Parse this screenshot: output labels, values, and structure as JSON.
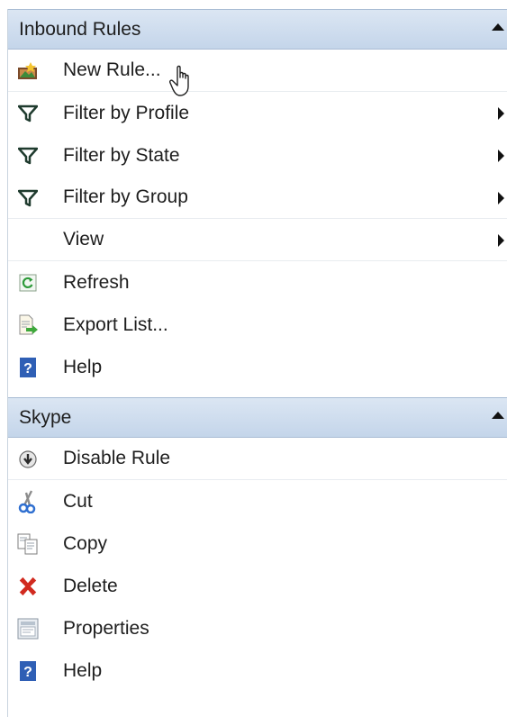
{
  "inbound": {
    "header": "Inbound Rules",
    "items": [
      {
        "label": "New Rule...",
        "icon": "new-rule-icon"
      },
      {
        "label": "Filter by Profile",
        "icon": "filter-icon"
      },
      {
        "label": "Filter by State",
        "icon": "filter-icon"
      },
      {
        "label": "Filter by Group",
        "icon": "filter-icon"
      },
      {
        "label": "View",
        "icon": ""
      },
      {
        "label": "Refresh",
        "icon": "refresh-icon"
      },
      {
        "label": "Export List...",
        "icon": "export-icon"
      },
      {
        "label": "Help",
        "icon": "help-icon"
      }
    ]
  },
  "skype": {
    "header": "Skype",
    "items": [
      {
        "label": "Disable Rule",
        "icon": "disable-icon"
      },
      {
        "label": "Cut",
        "icon": "cut-icon"
      },
      {
        "label": "Copy",
        "icon": "copy-icon"
      },
      {
        "label": "Delete",
        "icon": "delete-icon"
      },
      {
        "label": "Properties",
        "icon": "properties-icon"
      },
      {
        "label": "Help",
        "icon": "help-icon"
      }
    ]
  },
  "colors": {
    "header_bg": "#c4d5ea",
    "filter_icon": "#1f3b2e",
    "delete_icon": "#d12a1f",
    "help_icon": "#2f5fb5"
  }
}
